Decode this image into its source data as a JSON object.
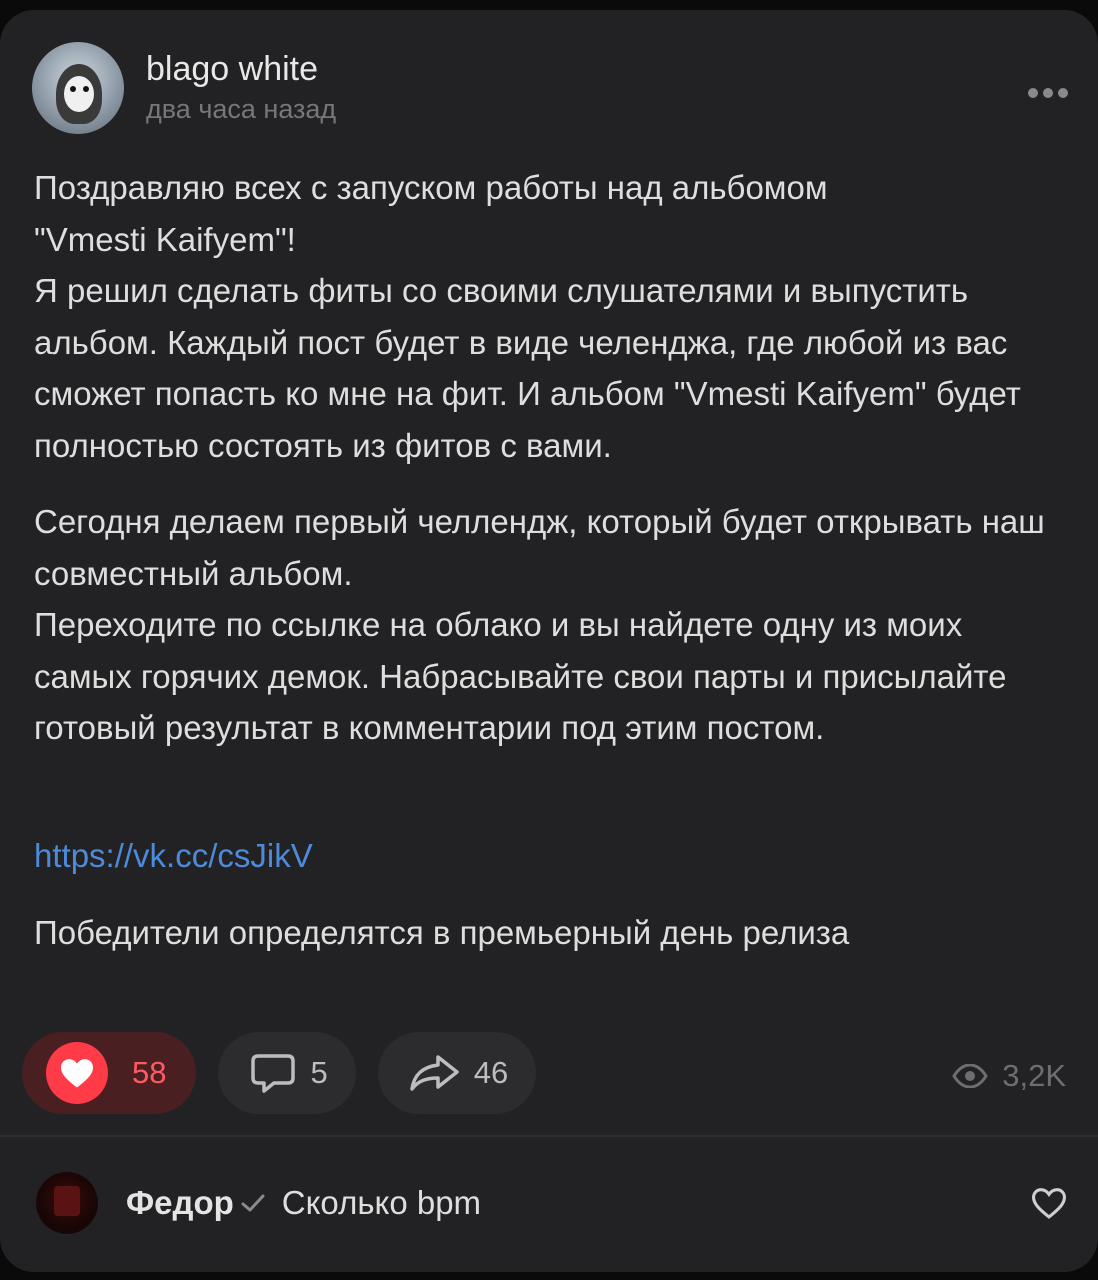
{
  "post": {
    "author": "blago white",
    "time": "два часа назад",
    "paragraphs": [
      "Поздравляю всех с запуском работы над альбомом\n\"Vmesti Kaifyem\"!\nЯ решил сделать фиты со своими слушателями и выпустить альбом. Каждый пост будет в виде челенджа, где любой из вас сможет попасть ко мне на фит. И альбом \"Vmesti Kaifyem\" будет полностью состоять из фитов с вами.",
      "Сегодня делаем первый челлендж, который будет открывать наш совместный альбом.\nПереходите по ссылке на облако и вы найдете одну из моих самых горячих демок. Набрасывайте свои парты и присылайте готовый результат в комментарии под этим постом."
    ],
    "link": "https://vk.cc/csJikV",
    "closing": "Победители определятся в премьерный день релиза"
  },
  "actions": {
    "likes": "58",
    "comments": "5",
    "shares": "46",
    "views": "3,2K"
  },
  "comment": {
    "author": "Федор",
    "text": "Сколько bpm"
  },
  "colors": {
    "card_bg": "#222224",
    "like_accent": "#ff3b47",
    "link": "#4d8ad9"
  },
  "icons": {
    "more": "more-horizontal-icon",
    "like": "heart-icon",
    "comment": "comment-bubble-icon",
    "share": "share-arrow-icon",
    "views": "eye-icon",
    "verified": "checkmark-icon",
    "comment_like": "heart-outline-icon"
  }
}
